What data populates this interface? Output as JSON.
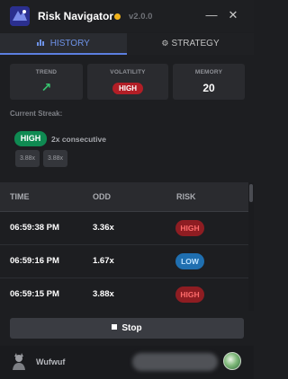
{
  "app": {
    "title": "Risk Navigator",
    "version": "v2.0.0",
    "status_color": "#f0b21b"
  },
  "window": {
    "minimize": "—",
    "close": "✕"
  },
  "tabs": [
    {
      "label": "HISTORY",
      "icon": "bar-chart-icon",
      "active": true
    },
    {
      "label": "STRATEGY",
      "icon": "gear-icon",
      "active": false
    }
  ],
  "stats": {
    "trend": {
      "label": "TREND",
      "value": "↗"
    },
    "volatility": {
      "label": "VOLATILITY",
      "value": "HIGH"
    },
    "memory": {
      "label": "MEMORY",
      "value": "20"
    }
  },
  "streak": {
    "title": "Current Streak:",
    "badge": "HIGH",
    "count": "2x consecutive",
    "chips": [
      "3.88x",
      "3.88x"
    ]
  },
  "table": {
    "headers": {
      "time": "TIME",
      "odd": "ODD",
      "risk": "RISK"
    },
    "rows": [
      {
        "time": "06:59:38 PM",
        "odd": "3.36x",
        "risk": "HIGH"
      },
      {
        "time": "06:59:16 PM",
        "odd": "1.67x",
        "risk": "LOW"
      },
      {
        "time": "06:59:15 PM",
        "odd": "3.88x",
        "risk": "HIGH"
      }
    ]
  },
  "controls": {
    "stop_label": "Stop"
  },
  "footer": {
    "username": "Wufwuf"
  },
  "colors": {
    "accent": "#5c7fe0",
    "high": "#b21e26",
    "low": "#1f6fb0",
    "trend_up": "#37c46f",
    "streak": "#0f8a52"
  }
}
